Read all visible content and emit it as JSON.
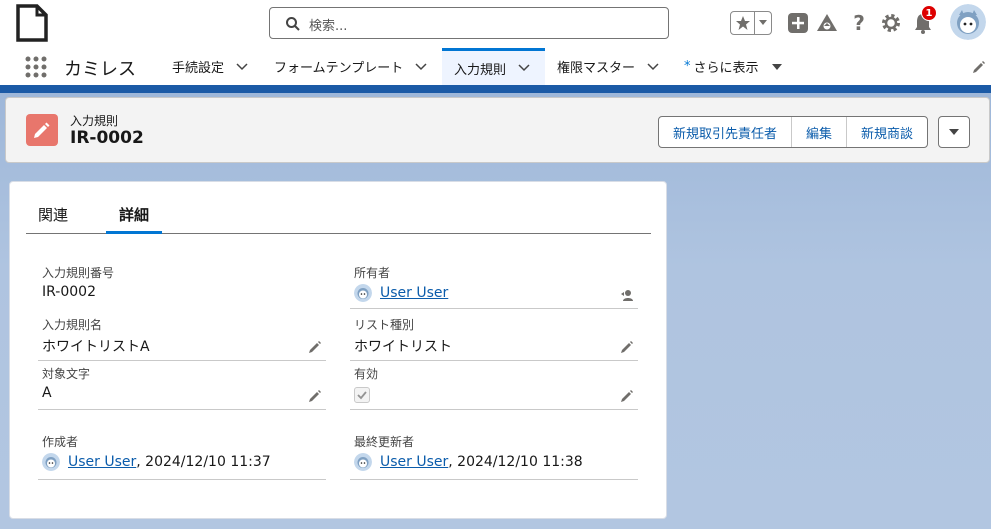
{
  "search": {
    "placeholder": "検索..."
  },
  "notifications": {
    "count": "1"
  },
  "app": {
    "name": "カミレス"
  },
  "nav": {
    "items": [
      {
        "label": "手続設定"
      },
      {
        "label": "フォームテンプレート"
      },
      {
        "label": "入力規則"
      },
      {
        "label": "権限マスター"
      },
      {
        "label": "さらに表示",
        "marker": "*"
      }
    ]
  },
  "record": {
    "type_label": "入力規則",
    "name": "IR-0002",
    "actions": [
      "新規取引先責任者",
      "編集",
      "新規商談"
    ]
  },
  "tabs": [
    "関連",
    "詳細"
  ],
  "fields": {
    "rule_number": {
      "label": "入力規則番号",
      "value": "IR-0002"
    },
    "owner": {
      "label": "所有者",
      "value": "User User"
    },
    "rule_name": {
      "label": "入力規則名",
      "value": "ホワイトリストA"
    },
    "list_type": {
      "label": "リスト種別",
      "value": "ホワイトリスト"
    },
    "target_char": {
      "label": "対象文字",
      "value": "A"
    },
    "active": {
      "label": "有効",
      "checked": true
    },
    "created_by": {
      "label": "作成者",
      "user": "User User",
      "date": ", 2024/12/10 11:37"
    },
    "modified_by": {
      "label": "最終更新者",
      "user": "User User",
      "date": ", 2024/12/10 11:38"
    }
  },
  "colors": {
    "brand": "#0176d3",
    "link": "#0b5cab",
    "record_icon": "#e8766c",
    "badge": "#dd0000"
  }
}
